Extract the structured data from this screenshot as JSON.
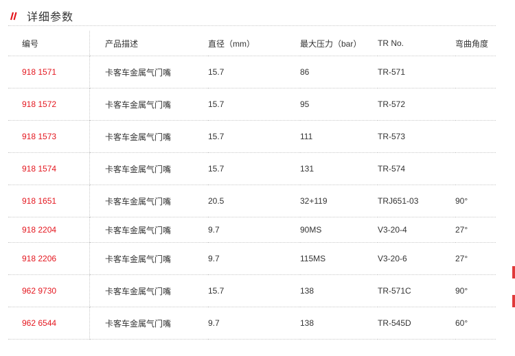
{
  "section": {
    "title": "详细参数"
  },
  "colors": {
    "accent": "#e4161e",
    "text": "#333333",
    "rule": "#c8c8c8"
  },
  "table": {
    "headers": [
      "编号",
      "产品描述",
      "直径（mm）",
      "最大压力（bar）",
      "TR No.",
      "弯曲角度"
    ],
    "rows": [
      {
        "code": "918 1571",
        "desc": "卡客车金属气门嘴",
        "diameter": "15.7",
        "pressure": "86",
        "tr": "TR-571",
        "angle": ""
      },
      {
        "code": "918 1572",
        "desc": "卡客车金属气门嘴",
        "diameter": "15.7",
        "pressure": "95",
        "tr": "TR-572",
        "angle": ""
      },
      {
        "code": "918 1573",
        "desc": "卡客车金属气门嘴",
        "diameter": "15.7",
        "pressure": "111",
        "tr": "TR-573",
        "angle": ""
      },
      {
        "code": "918 1574",
        "desc": "卡客车金属气门嘴",
        "diameter": "15.7",
        "pressure": "131",
        "tr": "TR-574",
        "angle": ""
      },
      {
        "code": "918 1651",
        "desc": "卡客车金属气门嘴",
        "diameter": "20.5",
        "pressure": "32+119",
        "tr": "TRJ651-03",
        "angle": "90°"
      },
      {
        "code": "918 2204",
        "desc": "卡客车金属气门嘴",
        "diameter": "9.7",
        "pressure": "90MS",
        "tr": "V3-20-4",
        "angle": "27°"
      },
      {
        "code": "918 2206",
        "desc": "卡客车金属气门嘴",
        "diameter": "9.7",
        "pressure": "115MS",
        "tr": "V3-20-6",
        "angle": "27°"
      },
      {
        "code": "962 9730",
        "desc": "卡客车金属气门嘴",
        "diameter": "15.7",
        "pressure": "138",
        "tr": "TR-571C",
        "angle": "90°"
      },
      {
        "code": "962 6544",
        "desc": "卡客车金属气门嘴",
        "diameter": "9.7",
        "pressure": "138",
        "tr": "TR-545D",
        "angle": "60°"
      }
    ]
  }
}
